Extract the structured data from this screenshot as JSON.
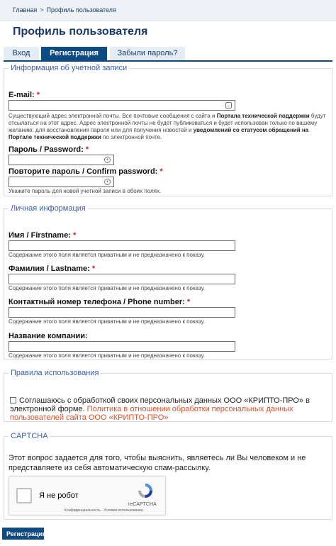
{
  "breadcrumb": {
    "home": "Главная",
    "separator": ">",
    "current": "Профиль пользователя"
  },
  "page_title": "Профиль пользователя",
  "tabs": [
    {
      "label": "Вход",
      "active": false
    },
    {
      "label": "Регистрация",
      "active": true
    },
    {
      "label": "Забыли пароль?",
      "active": false
    }
  ],
  "account": {
    "legend": "Информация об учетной записи",
    "email_label": "E-mail:",
    "email_value": "",
    "required_mark": "*",
    "email_desc_1": "Существующий адрес электронной почты. Все почтовые сообщения с сайта и ",
    "email_desc_b1": "Портала технической поддержки",
    "email_desc_2": " будут отсылаться на этот адрес. Адрес электронной почты не будет публиковаться и будет использован только по вашему желанию: для восстановления пароля или для получения новостей и ",
    "email_desc_b2": "уведомлений со статусом обращений на Портале технической поддержки",
    "email_desc_3": " по электронной почте.",
    "password_label": "Пароль / Password:",
    "confirm_label": "Повторите пароль / Confirm password:",
    "password_desc": "Укажите пароль для новой учетной записи в обоих полях."
  },
  "personal": {
    "legend": "Личная информация",
    "first_label": "Имя / Firstname:",
    "last_label": "Фамилия / Lastname:",
    "phone_label": "Контактный номер телефона / Phone number:",
    "company_label": "Название компании:",
    "private_desc": "Содержание этого поля является приватным и не предназначено к показу."
  },
  "rules": {
    "legend": "Правила использования",
    "agree_text": "Соглашаюсь с обработкой своих персональных данных ООО «КРИПТО-ПРО» в электронной форме. ",
    "agree_link": "Политика в отношении обработки персональных данных пользователей сайта ООО «КРИПТО-ПРО»",
    "checked": false
  },
  "captcha": {
    "legend": "CAPTCHA",
    "question": "Этот вопрос задается для того, чтобы выяснить, являетесь ли Вы человеком и не представляете из себя автоматическую спам-рассылку.",
    "robot_label": "Я не робот",
    "brand": "reCAPTCHA",
    "terms": "Конфиденциальность - Условия использования"
  },
  "submit_label": "Регистрация",
  "colors": {
    "primary": "#0f4a83",
    "legend": "#3a5ea8",
    "required": "#c82020",
    "link": "#d2522b"
  }
}
